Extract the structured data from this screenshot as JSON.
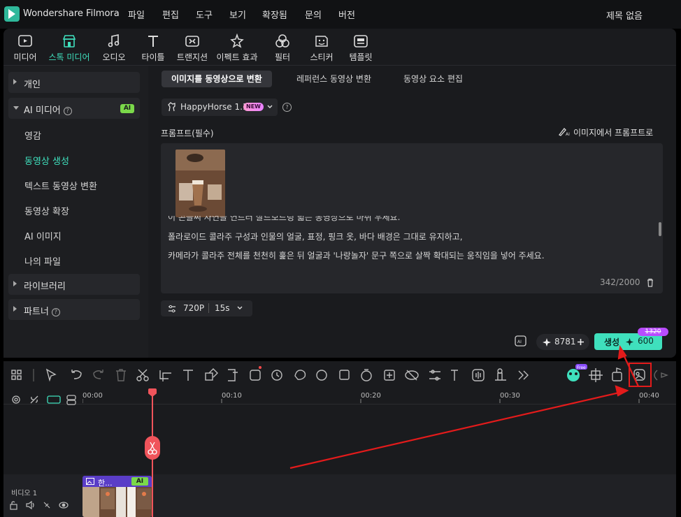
{
  "app": {
    "name": "Wondershare Filmora",
    "doc_title": "제목 없음"
  },
  "menu": [
    "파일",
    "편집",
    "도구",
    "보기",
    "확장됨",
    "문의",
    "버전"
  ],
  "toolbar": [
    {
      "label": "미디어",
      "icon": "media-icon"
    },
    {
      "label": "스톡 미디어",
      "icon": "stock-media-icon",
      "active": true
    },
    {
      "label": "오디오",
      "icon": "music-note-icon"
    },
    {
      "label": "타이틀",
      "icon": "title-t-icon"
    },
    {
      "label": "트랜지션",
      "icon": "transition-icon"
    },
    {
      "label": "이펙트 효과",
      "icon": "effects-icon"
    },
    {
      "label": "필터",
      "icon": "filter-icon"
    },
    {
      "label": "스티커",
      "icon": "sticker-icon"
    },
    {
      "label": "템플릿",
      "icon": "template-icon"
    }
  ],
  "sidebar": {
    "personal": "개인",
    "ai_media": "AI 미디어",
    "ai_badge": "AI",
    "items": [
      "영감",
      "동영상 생성",
      "텍스트 동영상 변환",
      "동영상 확장",
      "AI 이미지",
      "나의 파일"
    ],
    "library": "라이브러리",
    "partner": "파트너"
  },
  "tabs": [
    "이미지를 동영상으로 변환",
    "레퍼런스 동영상 변환",
    "동영상 요소 편집"
  ],
  "model": {
    "name": "HappyHorse 1.1",
    "badge": "NEW"
  },
  "prompt": {
    "label": "프롬프트(필수)",
    "image_to_prompt": "이미지에서 프롬프트로",
    "lines": [
      "이 콘을씨 자연을 연드러 살드보드링 넓는 동영상으로 마취 우세요.",
      "폴라로이드 콜라주 구성과 인물의 얼굴, 표정, 핑크 옷, 바다 배경은 그대로 유지하고,",
      "카메라가 콜라주 전체를 천천히 훑은 뒤 얼굴과 '나랑놀자' 문구 쪽으로 살짝 확대되는 움직임을 넣어 주세요."
    ],
    "char_count": "342/2000"
  },
  "settings": {
    "resolution": "720P",
    "duration": "15s"
  },
  "generate": {
    "credits": "8781",
    "label": "생성",
    "cost": "600",
    "old_cost": "1320"
  },
  "timeline": {
    "ticks": [
      "00:00",
      "00:10",
      "00:20",
      "00:30",
      "00:40"
    ],
    "track_label": "비디오 1",
    "clip_name": "한...",
    "clip_badge": "AI",
    "free_badge": "Free"
  },
  "colors": {
    "accent": "#3fe0bd",
    "playhead": "#f0545b",
    "highlight": "#e31b1b"
  }
}
